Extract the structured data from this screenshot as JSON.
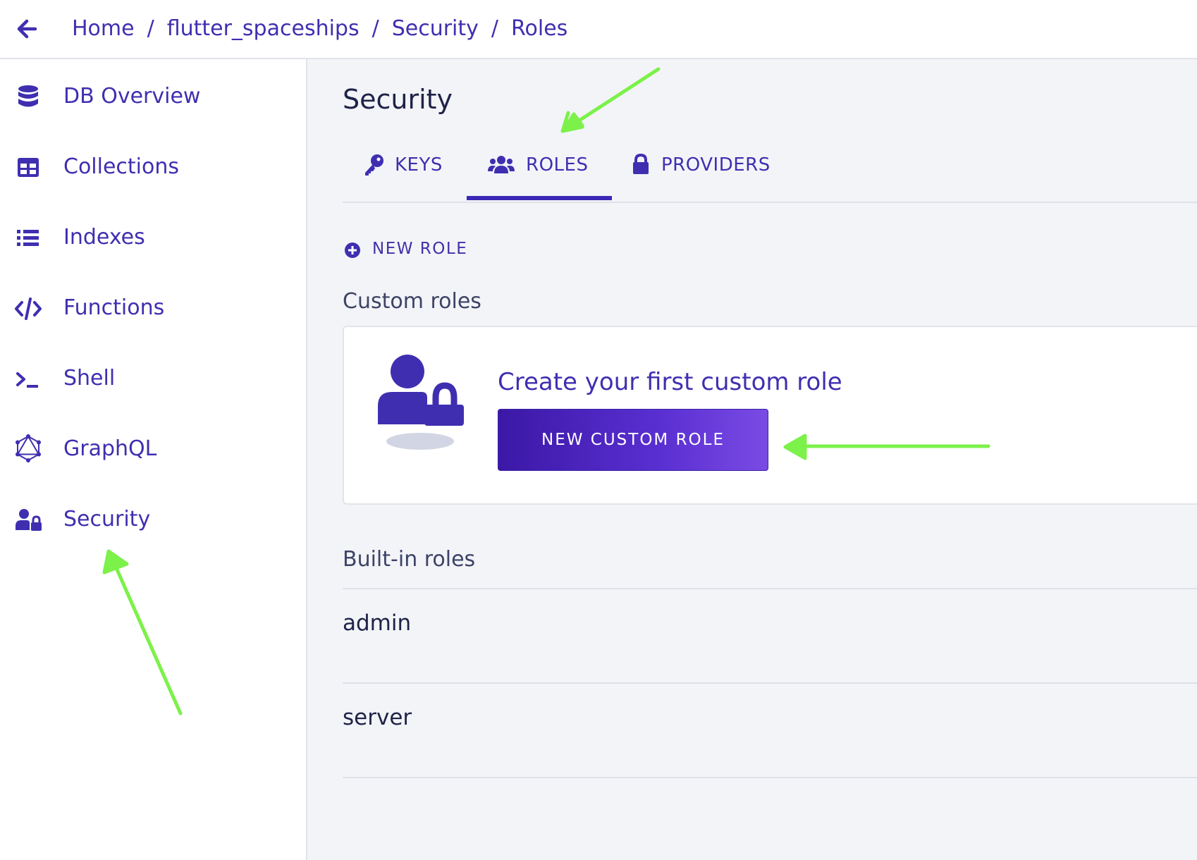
{
  "breadcrumb": {
    "items": [
      "Home",
      "flutter_spaceships",
      "Security",
      "Roles"
    ],
    "separator": "/"
  },
  "sidebar": {
    "items": [
      {
        "label": "DB Overview",
        "icon": "database-icon"
      },
      {
        "label": "Collections",
        "icon": "table-icon"
      },
      {
        "label": "Indexes",
        "icon": "list-icon"
      },
      {
        "label": "Functions",
        "icon": "code-icon"
      },
      {
        "label": "Shell",
        "icon": "terminal-icon"
      },
      {
        "label": "GraphQL",
        "icon": "graphql-icon"
      },
      {
        "label": "Security",
        "icon": "user-lock-icon"
      }
    ]
  },
  "main": {
    "title": "Security",
    "tabs": [
      {
        "label": "KEYS",
        "icon": "key-icon",
        "active": false
      },
      {
        "label": "ROLES",
        "icon": "users-icon",
        "active": true
      },
      {
        "label": "PROVIDERS",
        "icon": "lock-icon",
        "active": false
      }
    ],
    "new_role_label": "NEW ROLE",
    "custom_roles_heading": "Custom roles",
    "empty_state": {
      "title": "Create your first custom role",
      "button_label": "NEW CUSTOM ROLE"
    },
    "builtin_roles_heading": "Built-in roles",
    "builtin_roles": [
      "admin",
      "server"
    ]
  },
  "colors": {
    "accent": "#3f2fb0",
    "annotation": "#7cf14a",
    "background": "#f3f4f8"
  }
}
